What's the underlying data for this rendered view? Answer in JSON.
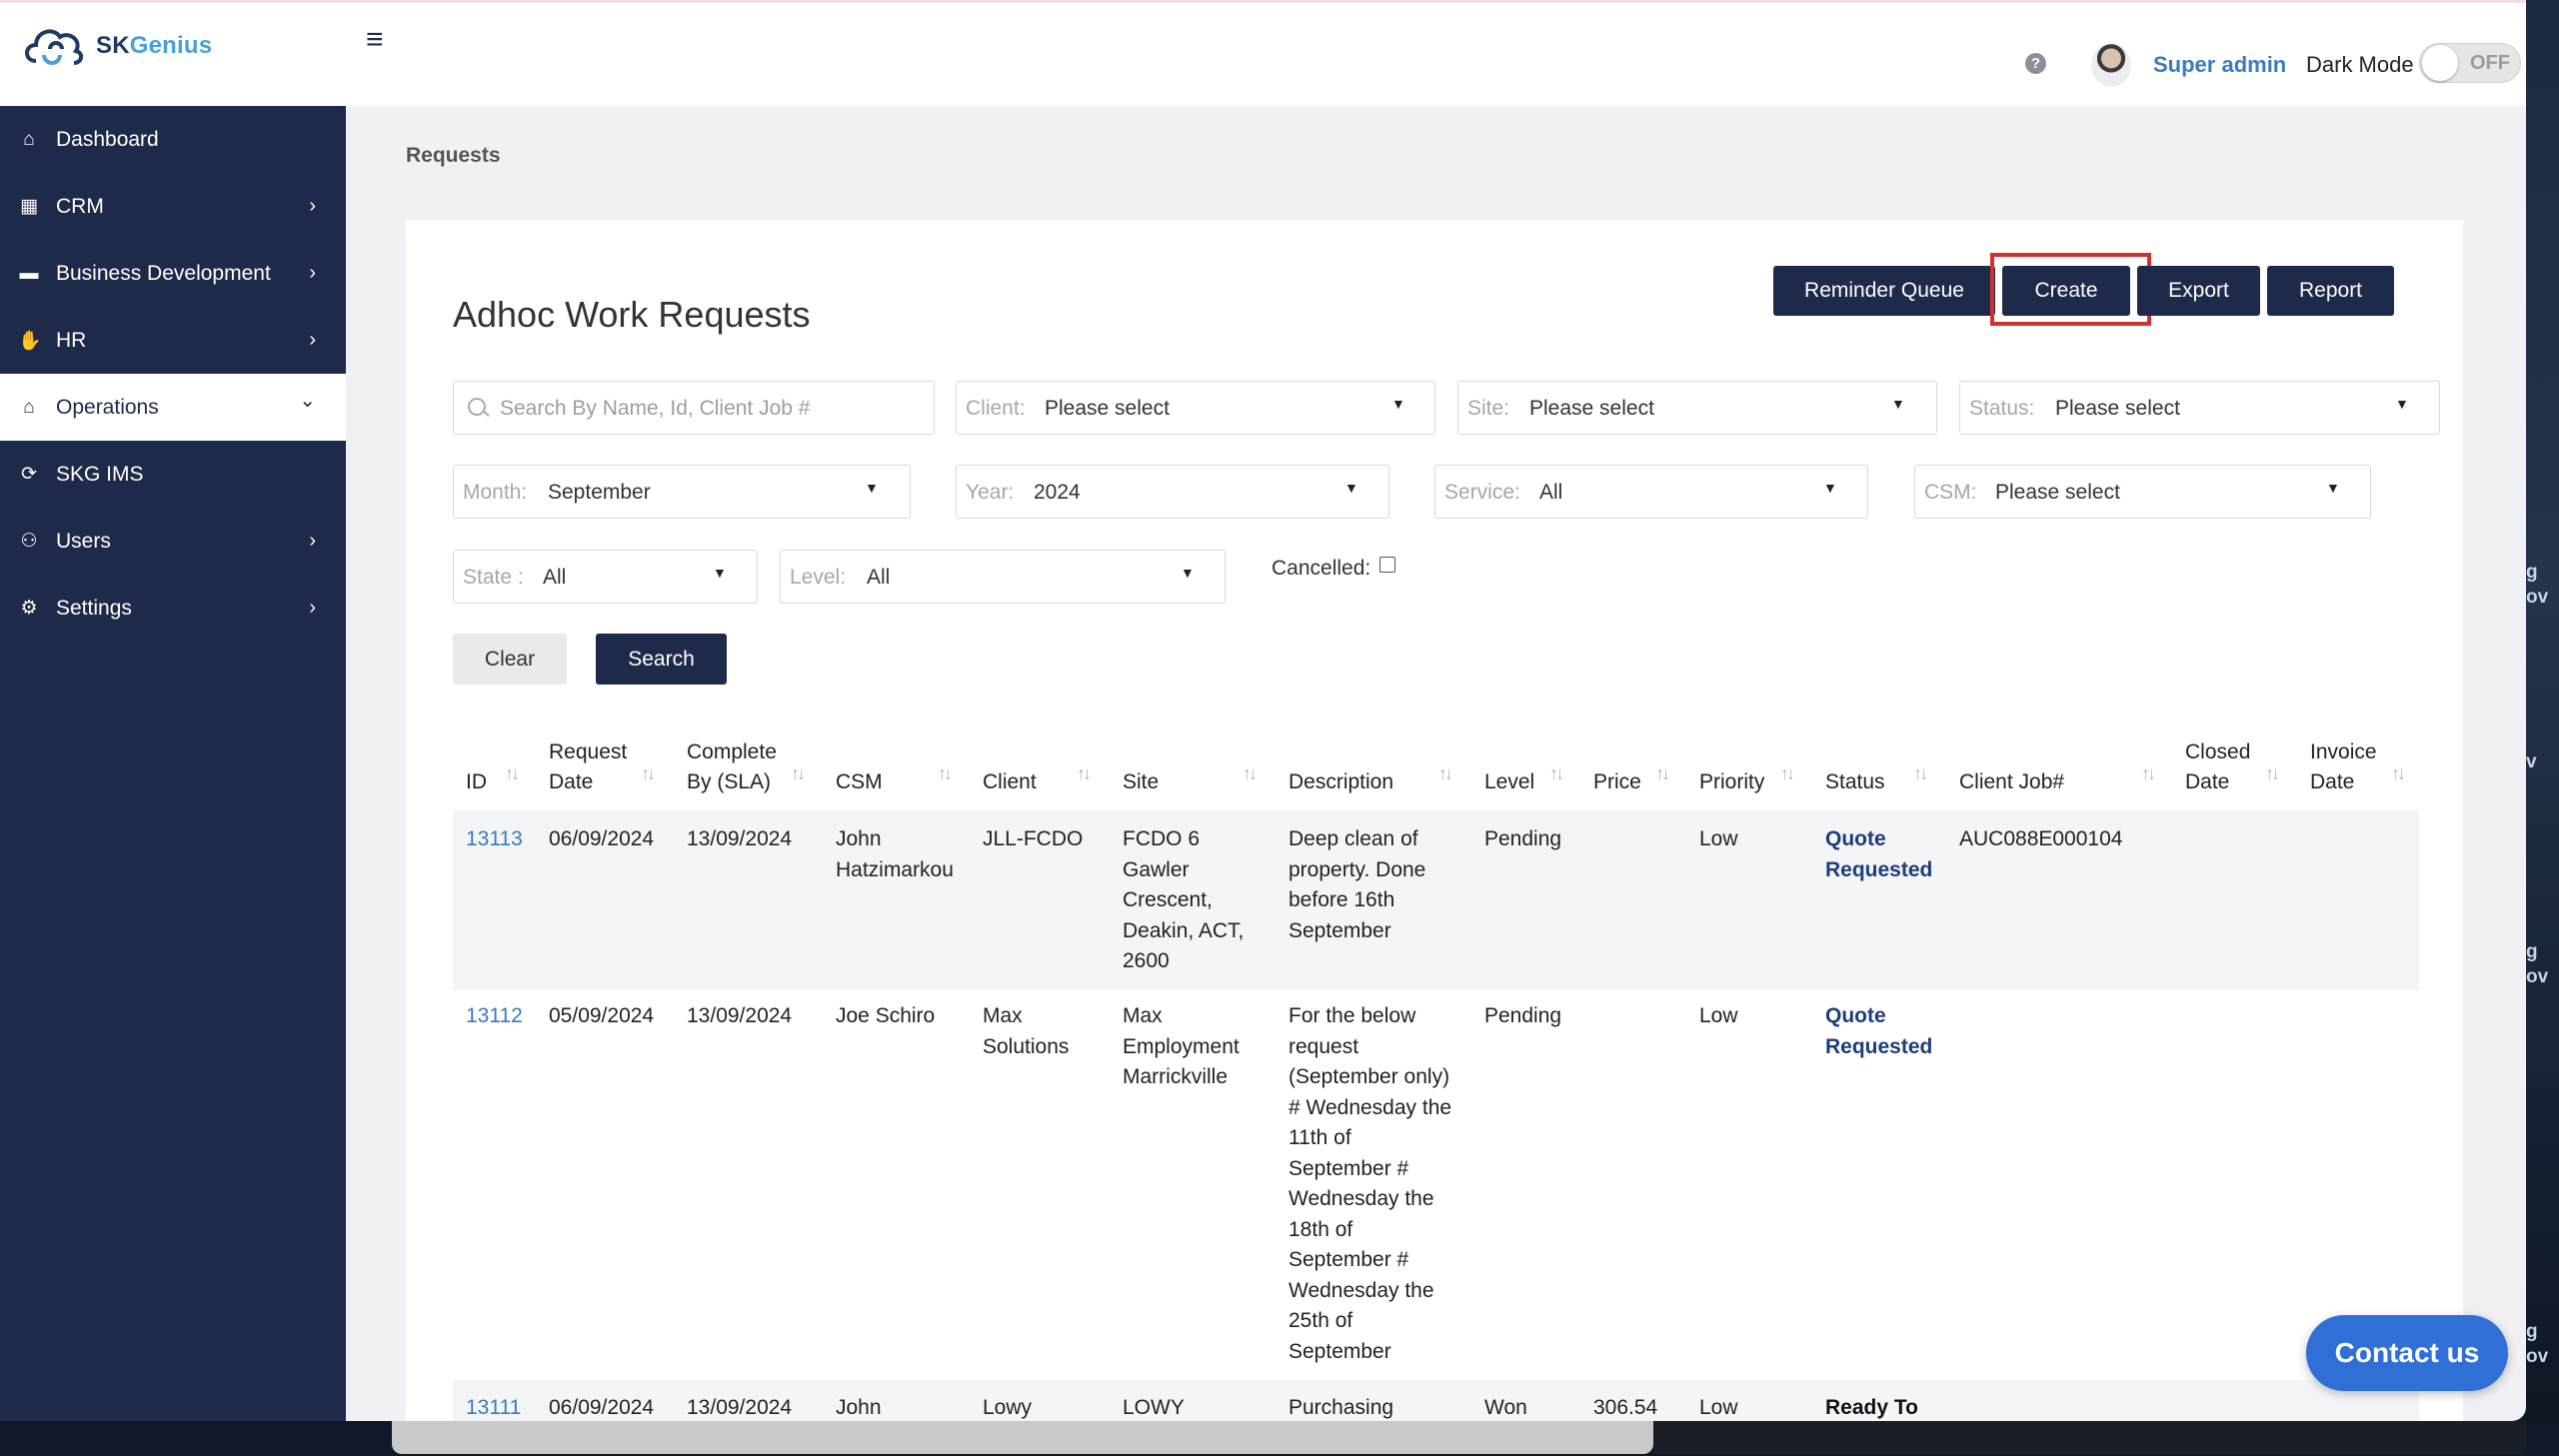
{
  "app": {
    "logo_text": "SKGenius",
    "logo_text_primary": "SK",
    "logo_text_accent": "Genius"
  },
  "header": {
    "user_name": "Super admin",
    "dark_mode_label": "Dark Mode",
    "dark_mode_state": "OFF"
  },
  "sidebar": {
    "items": [
      {
        "label": "Dashboard",
        "icon": "home-icon",
        "chevron": ""
      },
      {
        "label": "CRM",
        "icon": "building-icon",
        "chevron": "›"
      },
      {
        "label": "Business Development",
        "icon": "folder-icon",
        "chevron": "›"
      },
      {
        "label": "HR",
        "icon": "handshake-icon",
        "chevron": "›"
      },
      {
        "label": "Operations",
        "icon": "operations-icon",
        "chevron": "⌄"
      },
      {
        "label": "SKG IMS",
        "icon": "sync-icon",
        "chevron": ""
      },
      {
        "label": "Users",
        "icon": "users-icon",
        "chevron": "›"
      },
      {
        "label": "Settings",
        "icon": "gear-icon",
        "chevron": "›"
      }
    ],
    "active_item": "Operations"
  },
  "breadcrumb": "Requests",
  "page_title": "Adhoc Work Requests",
  "toolbar": {
    "reminder_queue": "Reminder Queue",
    "create": "Create",
    "export": "Export",
    "report": "Report"
  },
  "filters": {
    "search_placeholder": "Search By Name, Id, Client Job #",
    "client": {
      "label": "Client:",
      "value": "Please select"
    },
    "site": {
      "label": "Site:",
      "value": "Please select"
    },
    "status": {
      "label": "Status:",
      "value": "Please select"
    },
    "month": {
      "label": "Month:",
      "value": "September"
    },
    "year": {
      "label": "Year:",
      "value": "2024"
    },
    "service": {
      "label": "Service:",
      "value": "All"
    },
    "csm": {
      "label": "CSM:",
      "value": "Please select"
    },
    "state": {
      "label": "State :",
      "value": "All"
    },
    "level": {
      "label": "Level:",
      "value": "All"
    },
    "cancelled": {
      "label": "Cancelled:",
      "checked": false
    },
    "clear": "Clear",
    "search": "Search"
  },
  "table": {
    "columns": [
      [
        "ID"
      ],
      [
        "Request",
        "Date"
      ],
      [
        "Complete",
        "By (SLA)"
      ],
      [
        "CSM"
      ],
      [
        "Client"
      ],
      [
        "Site"
      ],
      [
        "Description"
      ],
      [
        "Level"
      ],
      [
        "Price"
      ],
      [
        "Priority"
      ],
      [
        "Status"
      ],
      [
        "Client Job#"
      ],
      [
        "Closed",
        "Date"
      ],
      [
        "Invoice",
        "Date"
      ]
    ],
    "rows": [
      {
        "id": "13113",
        "request_date": "06/09/2024",
        "complete_by": "13/09/2024",
        "csm": [
          "John",
          "Hatzimarkou"
        ],
        "client": [
          "JLL-FCDO"
        ],
        "site": [
          "FCDO 6",
          "Gawler",
          "Crescent,",
          "Deakin, ACT,",
          "2600"
        ],
        "description": [
          "Deep clean of",
          "property. Done",
          "before 16th",
          "September"
        ],
        "level": "Pending",
        "price": "",
        "priority": "Low",
        "status": [
          "Quote",
          "Requested"
        ],
        "client_job": "AUC088E000104",
        "closed_date": "",
        "invoice_date": ""
      },
      {
        "id": "13112",
        "request_date": "05/09/2024",
        "complete_by": "13/09/2024",
        "csm": [
          "Joe Schiro"
        ],
        "client": [
          "Max",
          "Solutions"
        ],
        "site": [
          "Max",
          "Employment",
          "Marrickville"
        ],
        "description": [
          "For the below",
          "request",
          "(September only)",
          "# Wednesday the",
          "11th of",
          "September #",
          "Wednesday the",
          "18th of",
          "September #",
          "Wednesday the",
          "25th of",
          "September"
        ],
        "level": "Pending",
        "price": "",
        "priority": "Low",
        "status": [
          "Quote",
          "Requested"
        ],
        "client_job": "",
        "closed_date": "",
        "invoice_date": ""
      },
      {
        "id": "13111",
        "request_date": "06/09/2024",
        "complete_by": "13/09/2024",
        "csm": [
          "John"
        ],
        "client": [
          "Lowy"
        ],
        "site": [
          "LOWY"
        ],
        "description": [
          "Purchasing"
        ],
        "level": "Won",
        "price": "306.54",
        "priority": "Low",
        "status": [
          "Ready To"
        ],
        "client_job": "",
        "closed_date": "",
        "invoice_date": ""
      }
    ]
  },
  "contact_button": "Contact us",
  "desktop_edge_text": [
    "g",
    "ov",
    "v",
    "g",
    "ov",
    "g",
    "ov"
  ],
  "colors": {
    "sidebar_bg": "#1e2a4a",
    "button_primary": "#1e2a4a",
    "link": "#3a7bbd",
    "status_text": "#1e3d7b",
    "highlight_border": "#d0312d",
    "contact_button": "#2f6fd6"
  }
}
